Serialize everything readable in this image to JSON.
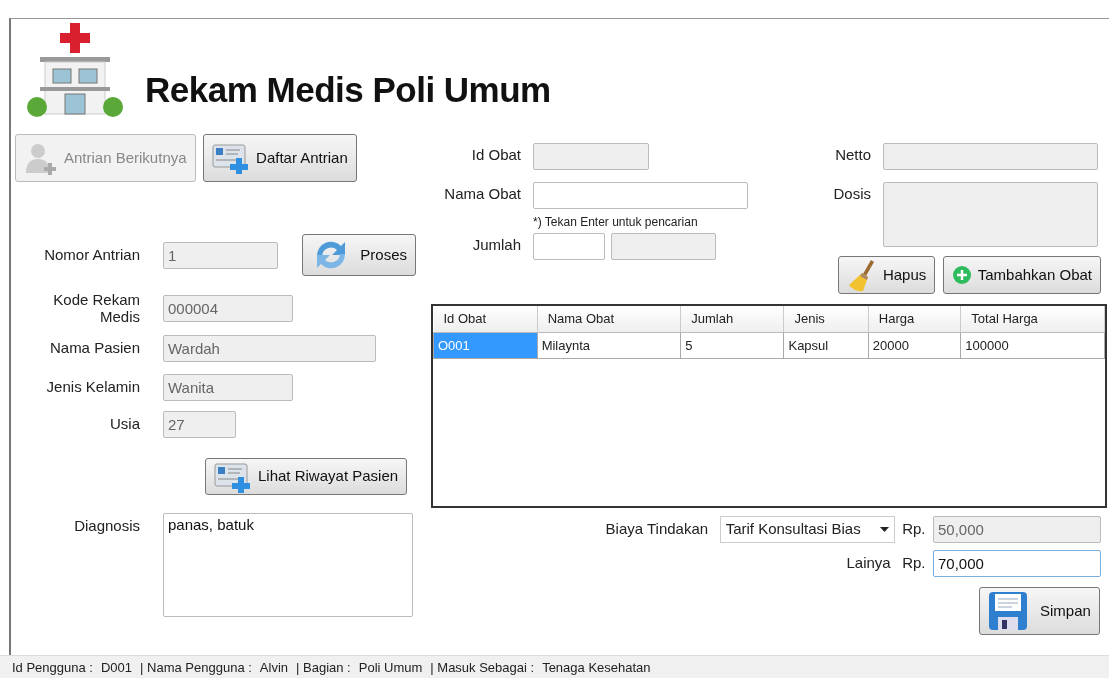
{
  "window": {
    "title": "Rekam Medis Poli Umum"
  },
  "queue_buttons": [
    {
      "kind": "person",
      "label": "Antrian Berikutnya",
      "disabled": true
    },
    {
      "kind": "card",
      "label": "Daftar Antrian",
      "disabled": false
    }
  ],
  "patient_fields": [
    {
      "label": "Nomor Antrian",
      "value": "1",
      "disabled": true
    },
    {
      "label": "Kode Rekam Medis",
      "value": "000004",
      "disabled": true
    },
    {
      "label": "Nama Pasien",
      "value": "Wardah",
      "disabled": true
    },
    {
      "label": "Jenis Kelamin",
      "value": "Wanita",
      "disabled": true
    },
    {
      "label": "Usia",
      "value": "27",
      "disabled": true
    }
  ],
  "process_button": {
    "label": "Proses"
  },
  "history_button": {
    "label": "Lihat Riwayat Pasien"
  },
  "diagnosis": {
    "label": "Diagnosis",
    "value": "panas, batuk"
  },
  "drug_form": {
    "id": {
      "label": "Id Obat",
      "disabled": true
    },
    "name": {
      "label": "Nama Obat",
      "disabled": false,
      "hint": "*) Tekan Enter untuk pencarian"
    },
    "amount": {
      "label": "Jumlah",
      "fields": [
        {
          "disabled": false
        },
        {
          "disabled": true
        }
      ]
    },
    "netto": {
      "label": "Netto",
      "disabled": true
    },
    "dose": {
      "label": "Dosis",
      "disabled": true
    },
    "buttons": [
      {
        "kind": "broom",
        "label": "Hapus"
      },
      {
        "kind": "plus",
        "label": "Tambahkan Obat"
      }
    ]
  },
  "table": {
    "columns": [
      "Id Obat",
      "Nama Obat",
      "Jumlah",
      "Jenis",
      "Harga",
      "Total Harga"
    ],
    "rows": [
      {
        "cells": [
          "O001",
          "Milaynta",
          "5",
          "Kapsul",
          "20000",
          "100000"
        ],
        "selected": true
      }
    ]
  },
  "fees": [
    {
      "kind": "dropdown",
      "label": "Biaya Tindakan",
      "option": "Tarif Konsultasi Bias",
      "currency": "Rp.",
      "value": "50,000",
      "disabled": true
    },
    {
      "kind": "plain",
      "label": "Lainya",
      "currency": "Rp.",
      "value": "70,000",
      "disabled": false
    }
  ],
  "save_button": {
    "label": "Simpan"
  },
  "status_bar": [
    {
      "label": "Id Pengguna :",
      "value": "D001"
    },
    {
      "label": "| Nama Pengguna :",
      "value": "Alvin"
    },
    {
      "label": "| Bagian :",
      "value": "Poli Umum"
    },
    {
      "label": "| Masuk Sebagai :",
      "value": "Tenaga Kesehatan"
    }
  ]
}
